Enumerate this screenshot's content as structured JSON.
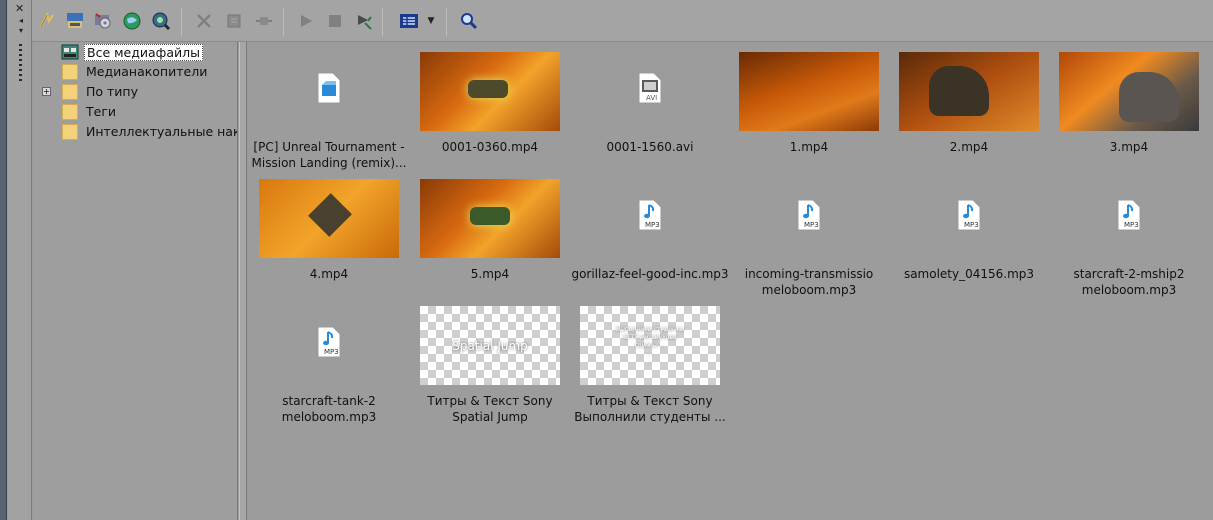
{
  "toolbar": {
    "buttons": [
      {
        "name": "import-media-icon",
        "enabled": true
      },
      {
        "name": "capture-video-icon",
        "enabled": true
      },
      {
        "name": "get-media-from-cd-icon",
        "enabled": true
      },
      {
        "name": "get-media-from-web-icon",
        "enabled": true
      },
      {
        "name": "media-fx-icon",
        "enabled": true
      },
      {
        "name": "remove-icon",
        "enabled": false
      },
      {
        "name": "properties-icon",
        "enabled": false
      },
      {
        "name": "plugins-icon",
        "enabled": false
      },
      {
        "name": "play-icon",
        "enabled": false
      },
      {
        "name": "stop-icon",
        "enabled": false
      },
      {
        "name": "auto-preview-icon",
        "enabled": true
      },
      {
        "name": "views-icon",
        "enabled": true
      },
      {
        "name": "search-icon",
        "enabled": true
      }
    ]
  },
  "tree": {
    "items": [
      {
        "label": "Все медиафайлы",
        "selected": true,
        "icon": "media-icon"
      },
      {
        "label": "Медианакопители",
        "icon": "folder-icon"
      },
      {
        "label": "По типу",
        "icon": "folder-icon",
        "expander": "+"
      },
      {
        "label": "Теги",
        "icon": "folder-icon"
      },
      {
        "label": "Интеллектуальные нако",
        "icon": "folder-icon"
      }
    ]
  },
  "media": [
    {
      "label": "[PC] Unreal Tournament - Mission Landing (remix)...",
      "kind": "project"
    },
    {
      "label": "0001-0360.mp4",
      "kind": "video"
    },
    {
      "label": "0001-1560.avi",
      "kind": "avi"
    },
    {
      "label": "1.mp4",
      "kind": "video"
    },
    {
      "label": "2.mp4",
      "kind": "video"
    },
    {
      "label": "3.mp4",
      "kind": "video"
    },
    {
      "label": "4.mp4",
      "kind": "video"
    },
    {
      "label": "5.mp4",
      "kind": "video"
    },
    {
      "label": "gorillaz-feel-good-inc.mp3",
      "kind": "mp3"
    },
    {
      "label": "incoming-transmissio meloboom.mp3",
      "kind": "mp3"
    },
    {
      "label": "samolety_04156.mp3",
      "kind": "mp3"
    },
    {
      "label": "starcraft-2-mship2 meloboom.mp3",
      "kind": "mp3"
    },
    {
      "label": "starcraft-tank-2 meloboom.mp3",
      "kind": "mp3"
    },
    {
      "label": "Титры & Текст Sony Spatial Jump",
      "kind": "title",
      "preview": "Spatial Jump"
    },
    {
      "label": "Титры & Текст Sony Выполнили студенты ...",
      "kind": "title-small",
      "preview_lines": [
        "Выполнили студенты",
        "БГТУ им. Шухова",
        "группы ...",
        "...",
        "..."
      ]
    }
  ],
  "file_badges": {
    "mp3": "MP3",
    "avi": "AVI"
  },
  "colors": {
    "accent_blue": "#2a8ad8",
    "folder": "#f3d27a"
  }
}
